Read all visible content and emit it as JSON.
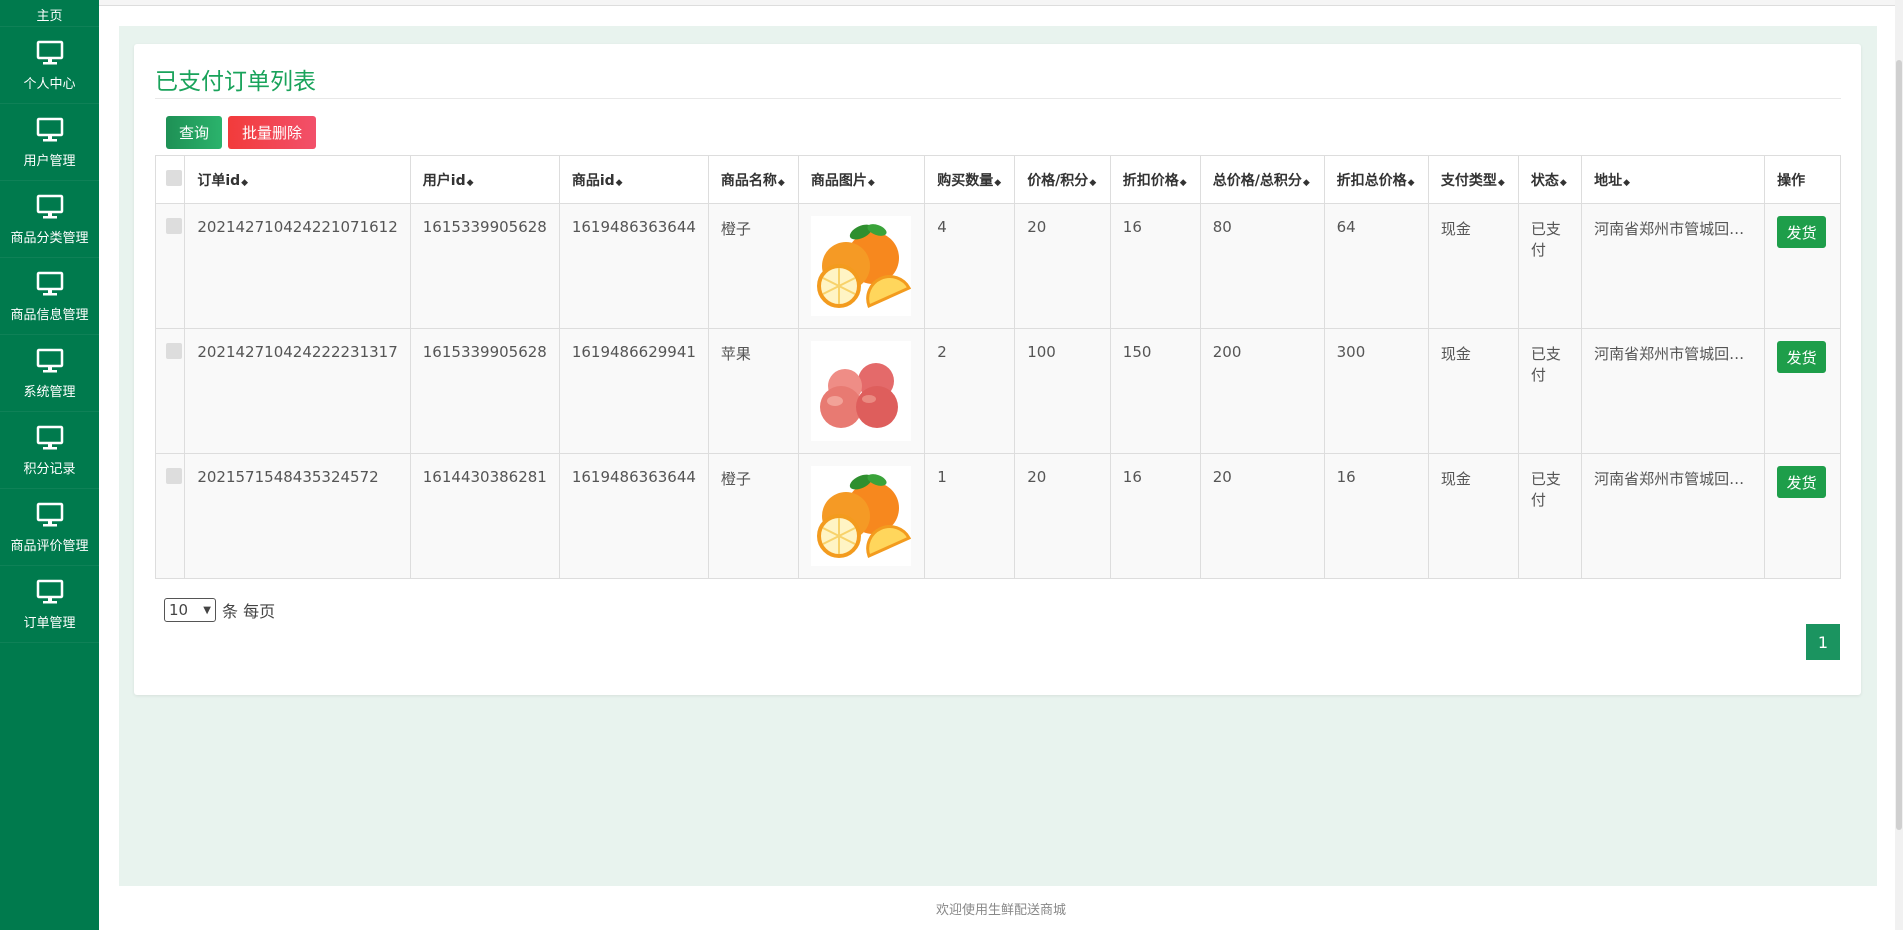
{
  "sidebar": {
    "items": [
      {
        "label": "主页",
        "icon": "monitor-icon"
      },
      {
        "label": "个人中心",
        "icon": "monitor-icon"
      },
      {
        "label": "用户管理",
        "icon": "monitor-icon"
      },
      {
        "label": "商品分类管理",
        "icon": "monitor-icon"
      },
      {
        "label": "商品信息管理",
        "icon": "monitor-icon"
      },
      {
        "label": "系统管理",
        "icon": "monitor-icon"
      },
      {
        "label": "积分记录",
        "icon": "monitor-icon"
      },
      {
        "label": "商品评价管理",
        "icon": "monitor-icon"
      },
      {
        "label": "订单管理",
        "icon": "monitor-icon"
      }
    ]
  },
  "main": {
    "title": "已支付订单列表",
    "query_label": "查询",
    "batch_delete_label": "批量删除",
    "columns": [
      "订单id",
      "用户id",
      "商品id",
      "商品名称",
      "商品图片",
      "购买数量",
      "价格/积分",
      "折扣价格",
      "总价格/总积分",
      "折扣总价格",
      "支付类型",
      "状态",
      "地址",
      "操作"
    ],
    "rows": [
      {
        "order_id": "202142710424221071612",
        "user_id": "1615339905628",
        "product_id": "1619486363644",
        "name": "橙子",
        "image": "orange-image",
        "qty": "4",
        "price": "20",
        "discount_price": "16",
        "total": "80",
        "discount_total": "64",
        "pay_type": "现金",
        "status": "已支付",
        "address": "河南省郑州市管城回族..",
        "action": "发货"
      },
      {
        "order_id": "202142710424222231317",
        "user_id": "1615339905628",
        "product_id": "1619486629941",
        "name": "苹果",
        "image": "apple-image",
        "qty": "2",
        "price": "100",
        "discount_price": "150",
        "total": "200",
        "discount_total": "300",
        "pay_type": "现金",
        "status": "已支付",
        "address": "河南省郑州市管城回族..",
        "action": "发货"
      },
      {
        "order_id": "2021571548435324572",
        "user_id": "1614430386281",
        "product_id": "1619486363644",
        "name": "橙子",
        "image": "orange-image",
        "qty": "1",
        "price": "20",
        "discount_price": "16",
        "total": "20",
        "discount_total": "16",
        "pay_type": "现金",
        "status": "已支付",
        "address": "河南省郑州市管城回族..",
        "action": "发货"
      }
    ],
    "pagination": {
      "page_size": "10",
      "per_page_label": "条 每页",
      "current_page": "1"
    }
  },
  "footer": {
    "text": "欢迎使用生鲜配送商城"
  },
  "colors": {
    "sidebar_bg": "#007a4d",
    "accent": "#1aa35b",
    "delete": "#f2404e",
    "ship_button": "#1e9e4a"
  }
}
